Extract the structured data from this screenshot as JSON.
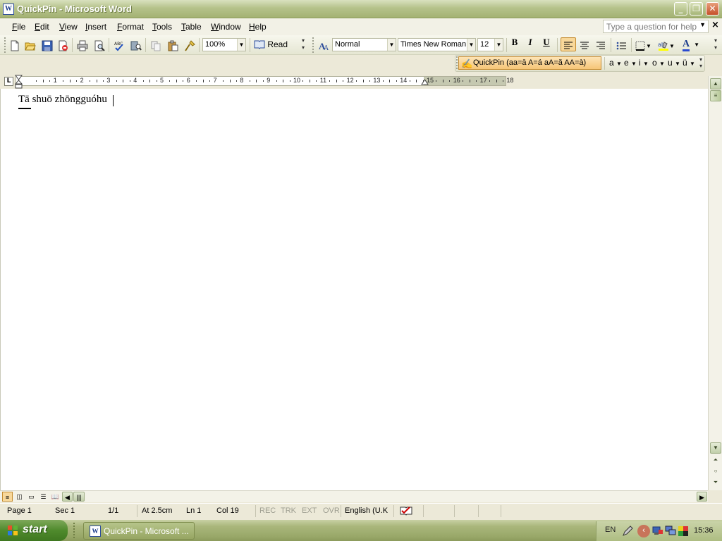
{
  "window": {
    "title": "QuickPin - Microsoft Word"
  },
  "caption_buttons": [
    "_",
    "❐",
    "✕"
  ],
  "menu": [
    {
      "label": "File",
      "key": "F",
      "rest": "ile"
    },
    {
      "label": "Edit",
      "key": "E",
      "rest": "dit"
    },
    {
      "label": "View",
      "key": "V",
      "rest": "iew"
    },
    {
      "label": "Insert",
      "key": "I",
      "rest": "nsert"
    },
    {
      "label": "Format",
      "key": "F",
      "rest": "ormat"
    },
    {
      "label": "Tools",
      "key": "T",
      "rest": "ools"
    },
    {
      "label": "Table",
      "key": "T",
      "rest": "able"
    },
    {
      "label": "Window",
      "key": "W",
      "rest": "indow"
    },
    {
      "label": "Help",
      "key": "H",
      "rest": "elp"
    }
  ],
  "help": {
    "placeholder": "Type a question for help"
  },
  "toolbar": {
    "zoom": "100%",
    "read_label": "Read",
    "style": "Normal",
    "font": "Times New Roman",
    "size": "12",
    "bold": "B",
    "italic": "I",
    "underline": "U",
    "font_color_label": "A"
  },
  "quickpin": {
    "label": "QuickPin  (aa=ā   A=á   aA=ǎ  AA=à)",
    "vowels": [
      "a",
      "e",
      "i",
      "o",
      "u",
      "ü"
    ]
  },
  "ruler": {
    "numbers": [
      "1",
      "2",
      "3",
      "4",
      "5",
      "6",
      "7",
      "8",
      "9",
      "10",
      "11",
      "12",
      "13",
      "14",
      "15",
      "16",
      "17",
      "18"
    ]
  },
  "document": {
    "text": "Tā shuō zhōngguóhu"
  },
  "status": {
    "page": "Page  1",
    "sec": "Sec  1",
    "pages": "1/1",
    "at": "At  2.5cm",
    "ln": "Ln  1",
    "col": "Col  19",
    "rec": "REC",
    "trk": "TRK",
    "ext": "EXT",
    "ovr": "OVR",
    "language": "English (U.K"
  },
  "taskbar": {
    "start": "start",
    "task_label": "QuickPin - Microsoft ...",
    "lang": "EN",
    "clock": "15:36"
  },
  "colors": {
    "accent_orange": "#f6c577",
    "title_olive": "#a4b273",
    "start_green": "#4f8a2c"
  }
}
